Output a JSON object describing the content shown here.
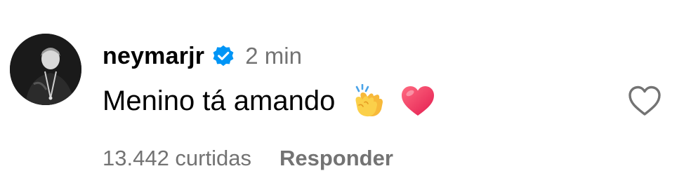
{
  "comment": {
    "username": "neymarjr",
    "verified": true,
    "time": "2 min",
    "text": "Menino tá amando",
    "emojis": [
      "clapping-hands",
      "red-heart"
    ],
    "likes": "13.442 curtidas",
    "reply_label": "Responder"
  },
  "colors": {
    "verified_badge": "#0095f6",
    "secondary_text": "#737373",
    "primary_text": "#000000"
  },
  "icons": {
    "verified": "verified-badge-icon",
    "like": "heart-outline-icon"
  }
}
